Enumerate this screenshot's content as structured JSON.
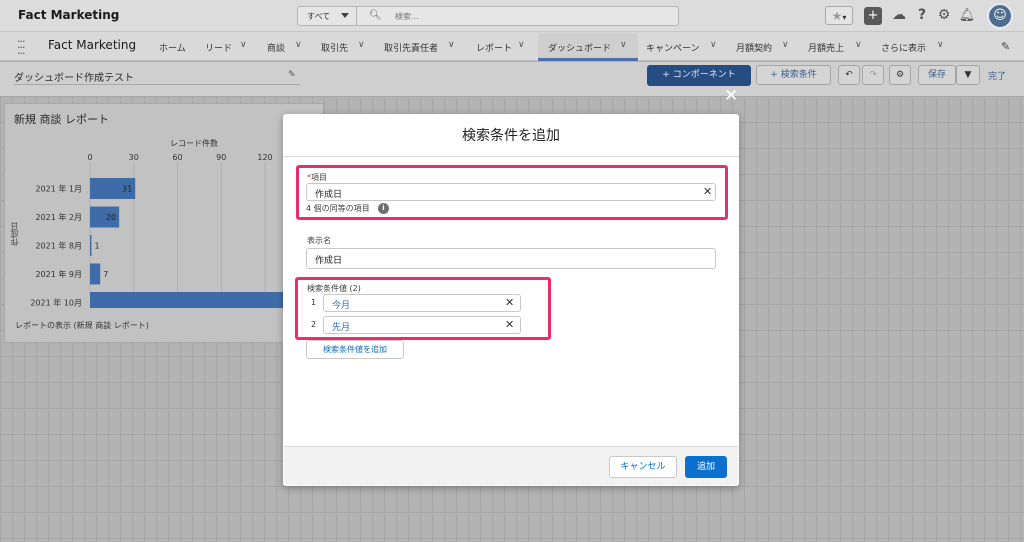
{
  "topbar": {
    "brand": "Fact Marketing",
    "search_scope": "すべて",
    "search_placeholder": "検索..."
  },
  "nav": {
    "app_name": "Fact Marketing",
    "items": [
      {
        "label": "ホーム",
        "has_menu": false
      },
      {
        "label": "リード",
        "has_menu": true
      },
      {
        "label": "商談",
        "has_menu": true
      },
      {
        "label": "取引先",
        "has_menu": true
      },
      {
        "label": "取引先責任者",
        "has_menu": true
      },
      {
        "label": "レポート",
        "has_menu": true
      },
      {
        "label": "ダッシュボード",
        "has_menu": true,
        "active": true
      },
      {
        "label": "キャンペーン",
        "has_menu": true
      },
      {
        "label": "月額契約",
        "has_menu": true
      },
      {
        "label": "月額売上",
        "has_menu": true
      },
      {
        "label": "さらに表示",
        "has_menu": true
      }
    ]
  },
  "dashboard": {
    "title": "ダッシュボード作成テスト",
    "add_component": "+ コンポーネント",
    "add_filter": "+ 検索条件",
    "save": "保存",
    "done": "完了"
  },
  "widget": {
    "title": "新規 商談 レポート",
    "view_report": "レポートの表示 (新規 商談 レポート)"
  },
  "chart_data": {
    "type": "bar",
    "orientation": "horizontal",
    "title": "",
    "xlabel": "レコード件数",
    "ylabel": "作成日",
    "categories": [
      "2021 年 1月",
      "2021 年 2月",
      "2021 年 8月",
      "2021 年 9月",
      "2021 年 10月"
    ],
    "values": [
      31,
      20,
      1,
      7,
      140
    ],
    "data_labels": [
      "31",
      "20",
      "1",
      "7",
      ""
    ],
    "x_ticks": [
      "0",
      "30",
      "60",
      "90",
      "120"
    ],
    "xlim": [
      0,
      130
    ],
    "bar_color": "#3f6ca8",
    "grid": true
  },
  "dialog": {
    "title": "検索条件を追加",
    "field_label": "項目",
    "required_mark": "*",
    "field_value": "作成日",
    "equivalent_fields": "4 個の同等の項目",
    "display_name_label": "表示名",
    "display_name_value": "作成日",
    "filter_values_label": "検索条件値 (2)",
    "filter_values": [
      {
        "index": "1",
        "value": "今月"
      },
      {
        "index": "2",
        "value": "先月"
      }
    ],
    "add_value_button": "検索条件値を追加",
    "cancel": "キャンセル",
    "add": "追加"
  },
  "colors": {
    "highlight": "#ec2b71",
    "brand_button": "#0c70d0",
    "link": "#0b6cbd"
  }
}
